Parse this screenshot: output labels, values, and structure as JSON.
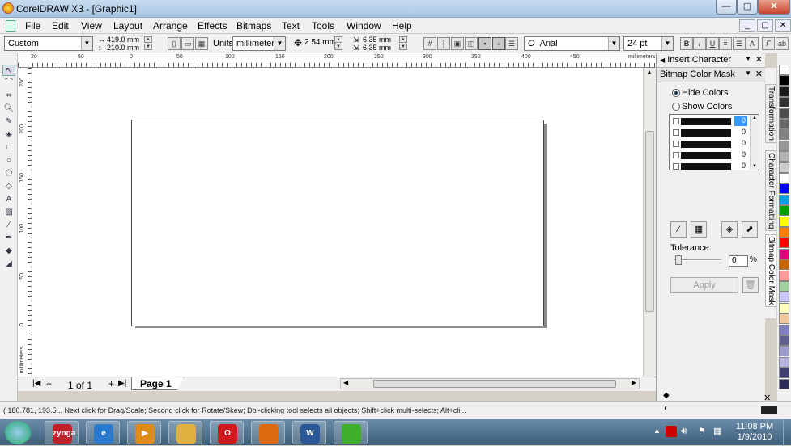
{
  "window": {
    "title": "CorelDRAW X3 - [Graphic1]",
    "minimize": "—",
    "maximize": "▢",
    "close": "✕"
  },
  "menu": [
    "File",
    "Edit",
    "View",
    "Layout",
    "Arrange",
    "Effects",
    "Bitmaps",
    "Text",
    "Tools",
    "Window",
    "Help"
  ],
  "mdi": {
    "minimize": "_",
    "restore": "▢",
    "close": "✕"
  },
  "propbar": {
    "preset": "Custom",
    "width": "419.0 mm",
    "height": "210.0 mm",
    "units_label": "Units:",
    "units": "millimeters",
    "nudge": "2.54 mm",
    "dup_x": "6.35 mm",
    "dup_y": "6.35 mm",
    "font": "Arial",
    "font_glyph": "O",
    "font_size": "24 pt",
    "bold": "B",
    "italic": "I",
    "underline": "U"
  },
  "ruler": {
    "h_labels": [
      "20",
      "50",
      "0",
      "50",
      "100",
      "150",
      "200",
      "250",
      "300",
      "350",
      "400",
      "450"
    ],
    "h_units": "millimeters",
    "v_labels": [
      "250",
      "200",
      "150",
      "100",
      "50",
      "0"
    ],
    "v_units": "millimeters"
  },
  "pagenav": {
    "current": "1 of 1",
    "tab": "Page 1"
  },
  "docker": {
    "insert_char": "Insert Character",
    "title": "Bitmap Color Mask",
    "hide": "Hide Colors",
    "show": "Show Colors",
    "colors": [
      {
        "value": "0",
        "color": "#111111"
      },
      {
        "value": "0",
        "color": "#111111"
      },
      {
        "value": "0",
        "color": "#111111"
      },
      {
        "value": "0",
        "color": "#111111"
      },
      {
        "value": "0",
        "color": "#111111"
      }
    ],
    "tolerance_label": "Tolerance:",
    "tolerance": "0",
    "percent": "%",
    "apply": "Apply"
  },
  "vtabs": [
    "Transformation",
    "Character Formatting",
    "Bitmap Color Mask"
  ],
  "palette": [
    "#ffffff",
    "#000000",
    "#1a1a1a",
    "#333333",
    "#4d4d4d",
    "#666666",
    "#808080",
    "#999999",
    "#b3b3b3",
    "#cccccc",
    "#ffffff",
    "#0000ff",
    "#00a0e0",
    "#00a000",
    "#ffff00",
    "#ff8000",
    "#ff0000",
    "#e0007a",
    "#c86400",
    "#ff9999",
    "#a0d0a0",
    "#c8c8ff",
    "#ffffc0",
    "#f0c8a0",
    "#8080c0",
    "#606090",
    "#9c9cc8",
    "#b4b4dc",
    "#404070",
    "#2c2c58"
  ],
  "status": "( 180.781, 193.5...   Next click for Drag/Scale; Second click for Rotate/Skew; Dbl-clicking tool selects all objects; Shift+click multi-selects; Alt+cli...",
  "taskbar": {
    "apps": [
      {
        "name": "zynga",
        "label": "zynga",
        "color": "#c0202a"
      },
      {
        "name": "ie",
        "label": "e",
        "color": "#2a7bd0"
      },
      {
        "name": "media",
        "label": "▶",
        "color": "#e08a1a"
      },
      {
        "name": "explorer",
        "label": "",
        "color": "#e0b040"
      },
      {
        "name": "opera",
        "label": "O",
        "color": "#d0191e"
      },
      {
        "name": "firefox",
        "label": "",
        "color": "#e06a10"
      },
      {
        "name": "word",
        "label": "W",
        "color": "#2b5797"
      },
      {
        "name": "coreldraw",
        "label": "",
        "color": "#3fae2a"
      }
    ],
    "time": "11:08 PM",
    "date": "1/9/2010"
  }
}
